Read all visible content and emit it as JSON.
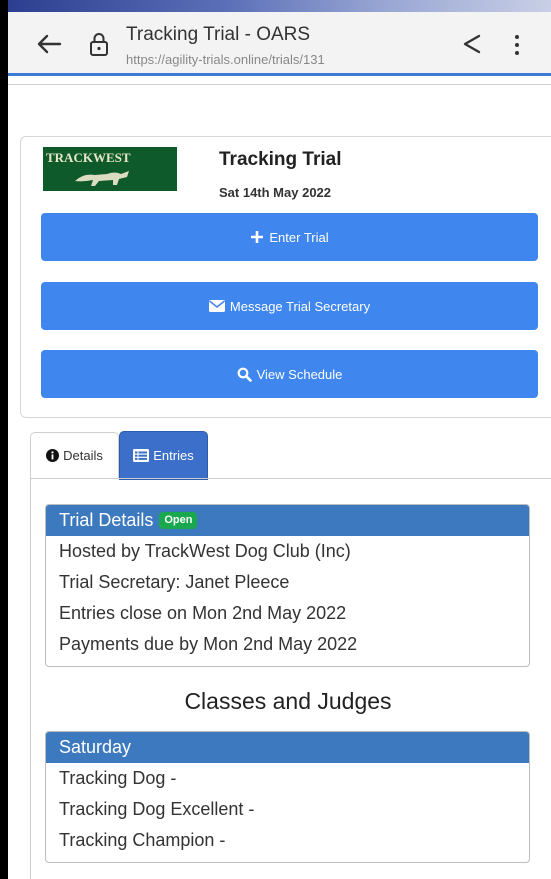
{
  "browser": {
    "page_title": "Tracking Trial - OARS",
    "url": "https://agility-trials.online/trials/131",
    "icons": [
      "back-arrow-icon",
      "lock-icon",
      "share-icon",
      "overflow-menu-icon"
    ]
  },
  "trial": {
    "logo_text": "TRACKWEST",
    "title": "Tracking Trial",
    "date": "Sat 14th May 2022",
    "buttons": {
      "enter": "Enter Trial",
      "message": "Message Trial Secretary",
      "schedule": "View Schedule"
    },
    "button_color": "#3f86ee"
  },
  "tabs": [
    {
      "label": "Details",
      "icon": "info-circle-icon",
      "active": true
    },
    {
      "label": "Entries",
      "icon": "list-icon",
      "active": false
    }
  ],
  "details": {
    "heading": "Trial Details",
    "status": "Open",
    "status_color": "#19a84e",
    "rows": [
      "Hosted by TrackWest Dog Club (Inc)",
      "Trial Secretary: Janet Pleece",
      "Entries close on Mon 2nd May 2022",
      "Payments due by Mon 2nd May 2022"
    ]
  },
  "classes": {
    "heading": "Classes and Judges",
    "days": [
      {
        "day": "Saturday",
        "rows": [
          "Tracking Dog -",
          "Tracking Dog Excellent -",
          "Tracking Champion -"
        ]
      }
    ]
  },
  "header_color": "#3c79bf"
}
